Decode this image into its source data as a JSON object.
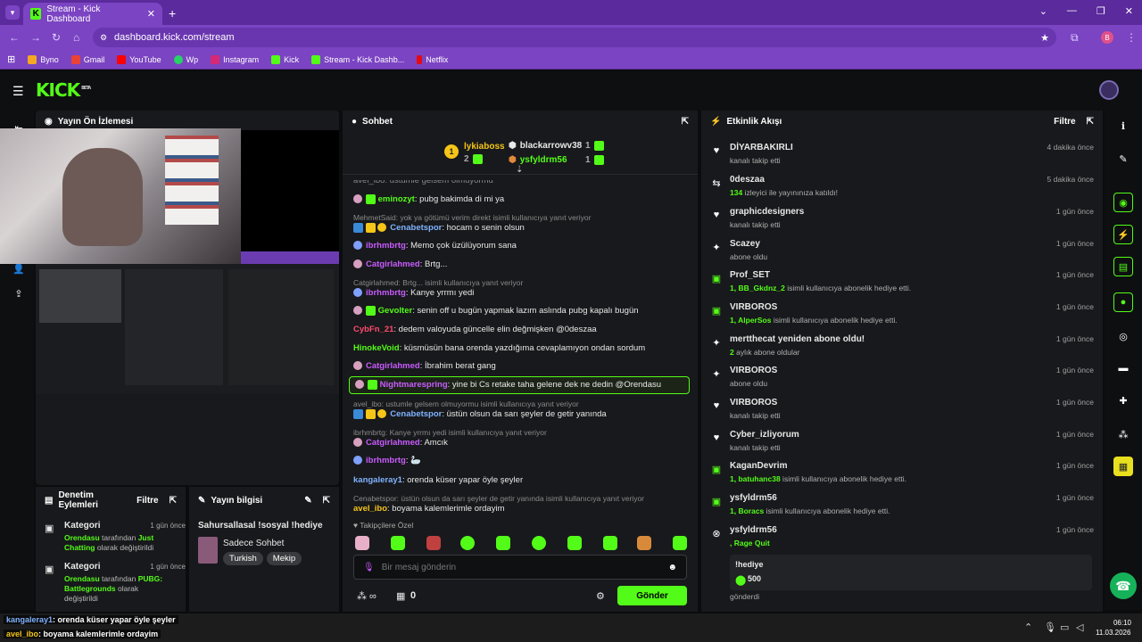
{
  "browser": {
    "tab_title": "Stream - Kick Dashboard",
    "url": "dashboard.kick.com/stream",
    "bookmarks": [
      {
        "label": "Byno",
        "color": "#f5a623"
      },
      {
        "label": "Gmail",
        "color": "#ea4335"
      },
      {
        "label": "YouTube",
        "color": "#ff0000"
      },
      {
        "label": "Wp",
        "color": "#25d366"
      },
      {
        "label": "Instagram",
        "color": "#d62976"
      },
      {
        "label": "Kick",
        "color": "#53fc18"
      },
      {
        "label": "Stream - Kick Dashb...",
        "color": "#53fc18"
      },
      {
        "label": "Netflix",
        "color": "#e50914"
      }
    ],
    "profile_initial": "B"
  },
  "app": {
    "logo": "KICK",
    "logo_sup": "BETA"
  },
  "preview": {
    "title": "Yayın Ön İzlemesi"
  },
  "chat": {
    "title": "Sohbet",
    "leaders": [
      {
        "name": "lykiaboss",
        "count": "2",
        "color": "#f5c518"
      },
      {
        "name": "blackarrowv38",
        "count": "1",
        "color": "#ffffff"
      },
      {
        "name": "ysfyldrm56",
        "count": "1",
        "color": "#53fc18"
      }
    ],
    "messages": [
      {
        "user": "eminozyt",
        "color": "#53fc18",
        "text": ": pubg bakimda di mi ya",
        "reply": ""
      },
      {
        "user": "Cenabetspor",
        "color": "#7fb3ff",
        "text": ": hocam o senin olsun",
        "reply": "MehmetSaid: yok ya götümü verim direkt isimli kullanıcıya yanıt veriyor"
      },
      {
        "user": "ibrhmbrtg",
        "color": "#c85bff",
        "text": ": Memo çok üzülüyorum sana",
        "reply": ""
      },
      {
        "user": "Catgirlahmed",
        "color": "#c85bff",
        "text": ": Brtg...",
        "reply": ""
      },
      {
        "user": "ibrhmbrtg",
        "color": "#c85bff",
        "text": ": Kanye yrrmı yedi",
        "reply": "Catgirlahmed: Brtg... isimli kullanıcıya yanıt veriyor"
      },
      {
        "user": "Gevolter",
        "color": "#53fc18",
        "text": ": senin off u bugün yapmak lazım aslında pubg kapalı bugün",
        "reply": ""
      },
      {
        "user": "CybFn_21",
        "color": "#ff4b6e",
        "text": ": dedem valoyuda güncelle elin değmişken @0deszaa",
        "reply": ""
      },
      {
        "user": "HinokeVoid",
        "color": "#53fc18",
        "text": ": küsmüsün bana orenda yazdığıma cevaplamıyon ondan sordum",
        "reply": ""
      },
      {
        "user": "Catgirlahmed",
        "color": "#c85bff",
        "text": ": İbrahim berat gang",
        "reply": ""
      },
      {
        "user": "Nightmarespring",
        "color": "#c85bff",
        "text": ": yine bi Cs retake taha gelene dek ne dedin @Orendasu",
        "reply": ""
      },
      {
        "user": "Cenabetspor",
        "color": "#7fb3ff",
        "text": ": üstün olsun da sarı şeyler de getir yanında",
        "reply": "avel_ibo: ustumle gelsem olmuyormu isimli kullanıcıya yanıt veriyor"
      },
      {
        "user": "Catgirlahmed",
        "color": "#c85bff",
        "text": ": Amcık",
        "reply": "ibrhmbrtg: Kanye yrrmı yedi isimli kullanıcıya yanıt veriyor"
      },
      {
        "user": "ibrhmbrtg",
        "color": "#c85bff",
        "text": ":",
        "reply": ""
      },
      {
        "user": "kangaleray1",
        "color": "#7fb3ff",
        "text": ": orenda küser yapar öyle şeyler",
        "reply": ""
      },
      {
        "user": "avel_ibo",
        "color": "#f5c518",
        "text": ": boyama kalemlerimle ordayim",
        "reply": "Cenabetspor: üstün olsun da sarı şeyler de getir yanında isimli kullanıcıya yanıt veriyor"
      }
    ],
    "truncated_top": "avel_ibo: ustumle gelsem olmuyormu",
    "emotes_label": "Takipçilere Özel",
    "input_placeholder": "Bir mesaj gönderin",
    "points": "0",
    "send_label": "Gönder"
  },
  "activity": {
    "title": "Etkinlik Akışı",
    "filter_label": "Filtre",
    "items": [
      {
        "icon": "heart-icon",
        "name": "DİYARBAKIRLI",
        "highlight": "",
        "sub": "kanalı takip etti",
        "time": "4 dakika önce"
      },
      {
        "icon": "raid-icon",
        "name": "0deszaa",
        "highlight": "134",
        "sub": " izleyici ile yayınınıza katıldı!",
        "time": "5 dakika önce"
      },
      {
        "icon": "heart-icon",
        "name": "graphicdesigners",
        "highlight": "",
        "sub": "kanalı takip etti",
        "time": "1 gün önce"
      },
      {
        "icon": "sparkle-icon",
        "name": "Scazey",
        "highlight": "",
        "sub": "abone oldu",
        "time": "1 gün önce"
      },
      {
        "icon": "gift-icon",
        "name": "Prof_SET",
        "highlight": "1, BB_Gkdnz_2",
        "sub": " isimli kullanıcıya abonelik hediye etti.",
        "time": "1 gün önce"
      },
      {
        "icon": "gift-icon",
        "name": "VIRBOROS",
        "highlight": "1, AlperSos",
        "sub": " isimli kullanıcıya abonelik hediye etti.",
        "time": "1 gün önce"
      },
      {
        "icon": "sparkle-icon",
        "name": "mertthecat yeniden abone oldu!",
        "highlight": "2",
        "sub": " aylık abone oldular",
        "time": "1 gün önce"
      },
      {
        "icon": "sparkle-icon",
        "name": "VIRBOROS",
        "highlight": "",
        "sub": "abone oldu",
        "time": "1 gün önce"
      },
      {
        "icon": "heart-icon",
        "name": "VIRBOROS",
        "highlight": "",
        "sub": "kanalı takip etti",
        "time": "1 gün önce"
      },
      {
        "icon": "heart-icon",
        "name": "Cyber_izliyorum",
        "highlight": "",
        "sub": "kanalı takip etti",
        "time": "1 gün önce"
      },
      {
        "icon": "gift-icon",
        "name": "KaganDevrim",
        "highlight": "1, batuhanc38",
        "sub": " isimli kullanıcıya abonelik hediye etti.",
        "time": "1 gün önce"
      },
      {
        "icon": "gift-icon",
        "name": "ysfyldrm56",
        "highlight": "1, Boracs",
        "sub": " isimli kullanıcıya abonelik hediye etti.",
        "time": "1 gün önce"
      },
      {
        "icon": "close-circle-icon",
        "name": "ysfyldrm56",
        "highlight": ", Rage Quit",
        "sub": "",
        "time": "1 gün önce"
      }
    ],
    "gift_text": "!hediye",
    "gift_amount": "500",
    "gift_footer": "gönderdi"
  },
  "moderation": {
    "title": "Denetim Eylemleri",
    "filter_label": "Filtre",
    "items": [
      {
        "label": "Kategori",
        "time": "1 gün önce",
        "actor": "Orendasu",
        "mid": " tarafından ",
        "value": "Just Chatting",
        "end": " olarak değiştirildi"
      },
      {
        "label": "Kategori",
        "time": "1 gün önce",
        "actor": "Orendasu",
        "mid": " tarafından ",
        "value": "PUBG: Battlegrounds",
        "end": " olarak değiştirildi"
      }
    ]
  },
  "stream_info": {
    "title": "Yayın bilgisi",
    "stream_title": "Sahursallasal !sosyal !hediye",
    "category": "Sadece Sohbet",
    "tags": [
      "Turkish",
      "Mekip"
    ]
  },
  "overlay": [
    {
      "user": "kangaleray1",
      "text": ": orenda küser yapar öyle şeyler",
      "color": "#7fb3ff"
    },
    {
      "user": "avel_ibo",
      "text": ": boyama kalemlerimle ordayim",
      "color": "#f5c518"
    }
  ],
  "taskbar": {
    "time": "06:10",
    "date": "11.03.2026"
  }
}
